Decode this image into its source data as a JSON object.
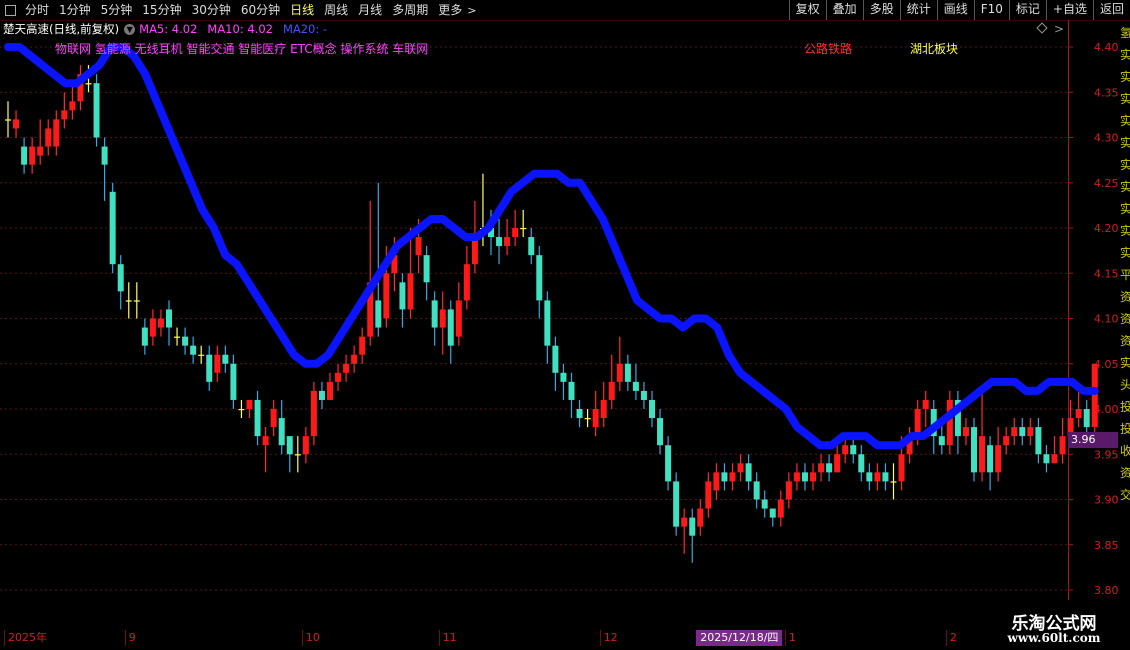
{
  "toolbar": {
    "periods": [
      "分时",
      "1分钟",
      "5分钟",
      "15分钟",
      "30分钟",
      "60分钟",
      "日线",
      "周线",
      "月线",
      "多周期",
      "更多"
    ],
    "active_period": "日线",
    "buttons": [
      "复权",
      "叠加",
      "多股",
      "统计",
      "画线",
      "F10",
      "标记",
      "+自选",
      "返回"
    ]
  },
  "info": {
    "stock_name": "楚天高速(日线,前复权)",
    "ma5": "MA5: 4.02",
    "ma10": "MA10: 4.02",
    "ma20": "MA20: -"
  },
  "concepts": "物联网 氢能源 无线耳机 智能交通 智能医疗 ETC概念 操作系统 车联网",
  "tags": {
    "road": "公路铁路",
    "hubei": "湖北板块"
  },
  "right_strip": "氢实实实实实实实实实实平资资资实头投投收资交",
  "price_tag": "3.96",
  "x_labels": [
    {
      "text": "2025年",
      "i": 0
    },
    {
      "text": "9",
      "i": 15
    },
    {
      "text": "10",
      "i": 37
    },
    {
      "text": "11",
      "i": 54
    },
    {
      "text": "12",
      "i": 74
    },
    {
      "text": "2025/12/18/四",
      "i": 86,
      "highlight": true
    },
    {
      "text": "1",
      "i": 97
    },
    {
      "text": "2",
      "i": 117
    }
  ],
  "watermark": {
    "title": "乐淘公式网",
    "url": "www.60lt.com"
  },
  "colors": {
    "up": "#ff1a1a",
    "down": "#40e0c0",
    "ma20": "#0a14ff",
    "ma_overlap": "#ff33ff",
    "axis": "#cc2222"
  },
  "chart_data": {
    "type": "candlestick",
    "title": "楚天高速(日线,前复权)",
    "ylim": [
      3.78,
      4.44
    ],
    "yticks": [
      3.8,
      3.85,
      3.9,
      3.95,
      4.0,
      4.05,
      4.1,
      4.15,
      4.2,
      4.25,
      4.3,
      4.35,
      4.4
    ],
    "candles": [
      [
        4.32,
        4.32,
        4.34,
        4.3
      ],
      [
        4.31,
        4.32,
        4.33,
        4.3
      ],
      [
        4.29,
        4.27,
        4.3,
        4.26
      ],
      [
        4.27,
        4.29,
        4.3,
        4.26
      ],
      [
        4.28,
        4.29,
        4.32,
        4.27
      ],
      [
        4.29,
        4.31,
        4.32,
        4.28
      ],
      [
        4.29,
        4.32,
        4.33,
        4.28
      ],
      [
        4.32,
        4.33,
        4.35,
        4.31
      ],
      [
        4.33,
        4.34,
        4.36,
        4.32
      ],
      [
        4.34,
        4.37,
        4.38,
        4.33
      ],
      [
        4.36,
        4.36,
        4.38,
        4.35
      ],
      [
        4.36,
        4.3,
        4.37,
        4.29
      ],
      [
        4.29,
        4.27,
        4.3,
        4.23
      ],
      [
        4.24,
        4.16,
        4.25,
        4.15
      ],
      [
        4.16,
        4.13,
        4.17,
        4.11
      ],
      [
        4.12,
        4.12,
        4.14,
        4.1
      ],
      [
        4.12,
        4.12,
        4.14,
        4.1
      ],
      [
        4.09,
        4.07,
        4.1,
        4.06
      ],
      [
        4.08,
        4.1,
        4.11,
        4.07
      ],
      [
        4.09,
        4.1,
        4.11,
        4.08
      ],
      [
        4.11,
        4.09,
        4.12,
        4.07
      ],
      [
        4.08,
        4.08,
        4.09,
        4.07
      ],
      [
        4.08,
        4.07,
        4.09,
        4.06
      ],
      [
        4.07,
        4.06,
        4.08,
        4.05
      ],
      [
        4.06,
        4.06,
        4.07,
        4.05
      ],
      [
        4.06,
        4.03,
        4.07,
        4.02
      ],
      [
        4.04,
        4.06,
        4.07,
        4.03
      ],
      [
        4.06,
        4.05,
        4.07,
        4.04
      ],
      [
        4.05,
        4.01,
        4.06,
        4.0
      ],
      [
        4.0,
        4.0,
        4.01,
        3.99
      ],
      [
        4.0,
        4.01,
        4.01,
        3.99
      ],
      [
        4.01,
        3.97,
        4.02,
        3.96
      ],
      [
        3.96,
        3.97,
        3.98,
        3.93
      ],
      [
        3.98,
        4.0,
        4.01,
        3.97
      ],
      [
        3.99,
        3.96,
        4.01,
        3.95
      ],
      [
        3.97,
        3.95,
        3.97,
        3.93
      ],
      [
        3.95,
        3.95,
        3.97,
        3.93
      ],
      [
        3.95,
        3.97,
        3.98,
        3.94
      ],
      [
        3.97,
        4.02,
        4.03,
        3.96
      ],
      [
        4.02,
        4.01,
        4.03,
        4.0
      ],
      [
        4.01,
        4.03,
        4.04,
        4.01
      ],
      [
        4.03,
        4.04,
        4.05,
        4.02
      ],
      [
        4.04,
        4.05,
        4.06,
        4.03
      ],
      [
        4.05,
        4.06,
        4.07,
        4.04
      ],
      [
        4.06,
        4.08,
        4.09,
        4.05
      ],
      [
        4.08,
        4.14,
        4.23,
        4.07
      ],
      [
        4.12,
        4.09,
        4.25,
        4.08
      ],
      [
        4.1,
        4.15,
        4.18,
        4.09
      ],
      [
        4.15,
        4.17,
        4.19,
        4.13
      ],
      [
        4.14,
        4.11,
        4.15,
        4.09
      ],
      [
        4.11,
        4.15,
        4.2,
        4.1
      ],
      [
        4.17,
        4.19,
        4.21,
        4.15
      ],
      [
        4.17,
        4.14,
        4.18,
        4.12
      ],
      [
        4.12,
        4.09,
        4.13,
        4.07
      ],
      [
        4.09,
        4.11,
        4.13,
        4.06
      ],
      [
        4.11,
        4.07,
        4.12,
        4.05
      ],
      [
        4.08,
        4.12,
        4.14,
        4.07
      ],
      [
        4.12,
        4.16,
        4.18,
        4.11
      ],
      [
        4.16,
        4.19,
        4.23,
        4.15
      ],
      [
        4.2,
        4.2,
        4.26,
        4.18
      ],
      [
        4.2,
        4.19,
        4.22,
        4.17
      ],
      [
        4.19,
        4.18,
        4.21,
        4.16
      ],
      [
        4.18,
        4.19,
        4.21,
        4.17
      ],
      [
        4.19,
        4.2,
        4.22,
        4.18
      ],
      [
        4.2,
        4.2,
        4.22,
        4.19
      ],
      [
        4.19,
        4.17,
        4.2,
        4.16
      ],
      [
        4.17,
        4.12,
        4.18,
        4.1
      ],
      [
        4.12,
        4.07,
        4.13,
        4.05
      ],
      [
        4.07,
        4.04,
        4.08,
        4.02
      ],
      [
        4.04,
        4.03,
        4.05,
        4.01
      ],
      [
        4.03,
        4.01,
        4.04,
        3.99
      ],
      [
        4.0,
        3.99,
        4.01,
        3.98
      ],
      [
        3.99,
        3.99,
        4.0,
        3.98
      ],
      [
        3.98,
        4.0,
        4.02,
        3.97
      ],
      [
        3.99,
        4.01,
        4.03,
        3.98
      ],
      [
        4.01,
        4.03,
        4.06,
        4.0
      ],
      [
        4.03,
        4.05,
        4.08,
        4.02
      ],
      [
        4.05,
        4.03,
        4.06,
        4.02
      ],
      [
        4.03,
        4.02,
        4.05,
        4.01
      ],
      [
        4.02,
        4.01,
        4.03,
        4.0
      ],
      [
        4.01,
        3.99,
        4.02,
        3.98
      ],
      [
        3.99,
        3.96,
        4.0,
        3.95
      ],
      [
        3.96,
        3.92,
        3.97,
        3.91
      ],
      [
        3.92,
        3.87,
        3.93,
        3.86
      ],
      [
        3.87,
        3.88,
        3.89,
        3.84
      ],
      [
        3.88,
        3.86,
        3.89,
        3.83
      ],
      [
        3.87,
        3.89,
        3.9,
        3.86
      ],
      [
        3.89,
        3.92,
        3.93,
        3.88
      ],
      [
        3.91,
        3.93,
        3.94,
        3.9
      ],
      [
        3.93,
        3.92,
        3.94,
        3.91
      ],
      [
        3.92,
        3.93,
        3.94,
        3.91
      ],
      [
        3.93,
        3.94,
        3.95,
        3.92
      ],
      [
        3.94,
        3.92,
        3.95,
        3.91
      ],
      [
        3.92,
        3.9,
        3.93,
        3.89
      ],
      [
        3.9,
        3.89,
        3.91,
        3.88
      ],
      [
        3.89,
        3.88,
        3.89,
        3.87
      ],
      [
        3.88,
        3.9,
        3.91,
        3.87
      ],
      [
        3.9,
        3.92,
        3.93,
        3.89
      ],
      [
        3.92,
        3.93,
        3.94,
        3.91
      ],
      [
        3.93,
        3.92,
        3.94,
        3.91
      ],
      [
        3.92,
        3.93,
        3.94,
        3.91
      ],
      [
        3.93,
        3.94,
        3.95,
        3.92
      ],
      [
        3.94,
        3.93,
        3.95,
        3.92
      ],
      [
        3.93,
        3.95,
        3.96,
        3.93
      ],
      [
        3.95,
        3.96,
        3.97,
        3.94
      ],
      [
        3.96,
        3.95,
        3.97,
        3.94
      ],
      [
        3.95,
        3.93,
        3.96,
        3.92
      ],
      [
        3.93,
        3.92,
        3.94,
        3.91
      ],
      [
        3.92,
        3.93,
        3.94,
        3.91
      ],
      [
        3.93,
        3.92,
        3.94,
        3.91
      ],
      [
        3.92,
        3.92,
        3.94,
        3.9
      ],
      [
        3.92,
        3.95,
        3.97,
        3.91
      ],
      [
        3.95,
        3.97,
        3.98,
        3.94
      ],
      [
        3.97,
        4.0,
        4.01,
        3.96
      ],
      [
        4.0,
        4.01,
        4.02,
        3.98
      ],
      [
        4.0,
        3.97,
        4.01,
        3.95
      ],
      [
        3.97,
        3.96,
        3.99,
        3.95
      ],
      [
        3.96,
        4.01,
        4.02,
        3.95
      ],
      [
        4.01,
        3.97,
        4.02,
        3.95
      ],
      [
        3.97,
        3.98,
        3.99,
        3.96
      ],
      [
        3.98,
        3.93,
        3.99,
        3.92
      ],
      [
        3.93,
        3.97,
        4.02,
        3.92
      ],
      [
        3.96,
        3.93,
        3.97,
        3.91
      ],
      [
        3.93,
        3.96,
        3.98,
        3.92
      ],
      [
        3.96,
        3.97,
        3.98,
        3.95
      ],
      [
        3.97,
        3.98,
        3.99,
        3.96
      ],
      [
        3.98,
        3.97,
        3.99,
        3.96
      ],
      [
        3.97,
        3.98,
        3.99,
        3.96
      ],
      [
        3.98,
        3.95,
        3.99,
        3.94
      ],
      [
        3.95,
        3.94,
        3.96,
        3.93
      ],
      [
        3.94,
        3.95,
        3.97,
        3.94
      ],
      [
        3.95,
        3.97,
        3.99,
        3.94
      ],
      [
        3.97,
        3.99,
        4.01,
        3.96
      ],
      [
        3.99,
        4.0,
        4.02,
        3.98
      ],
      [
        4.0,
        3.98,
        4.01,
        3.97
      ],
      [
        3.98,
        4.05,
        4.05,
        3.97
      ]
    ],
    "ma20": [
      4.4,
      4.4,
      4.39,
      4.38,
      4.37,
      4.36,
      4.36,
      4.37,
      4.38,
      4.4,
      4.4,
      4.39,
      4.37,
      4.34,
      4.31,
      4.28,
      4.25,
      4.22,
      4.2,
      4.17,
      4.16,
      4.14,
      4.12,
      4.1,
      4.08,
      4.06,
      4.05,
      4.05,
      4.06,
      4.08,
      4.1,
      4.12,
      4.14,
      4.16,
      4.18,
      4.19,
      4.2,
      4.21,
      4.21,
      4.2,
      4.19,
      4.19,
      4.2,
      4.22,
      4.24,
      4.25,
      4.26,
      4.26,
      4.26,
      4.25,
      4.25,
      4.23,
      4.21,
      4.18,
      4.15,
      4.12,
      4.11,
      4.1,
      4.1,
      4.09,
      4.1,
      4.1,
      4.09,
      4.06,
      4.04,
      4.03,
      4.02,
      4.01,
      4.0,
      3.98,
      3.97,
      3.96,
      3.96,
      3.97,
      3.97,
      3.97,
      3.96,
      3.96,
      3.96,
      3.97,
      3.97,
      3.98,
      3.99,
      4.0,
      4.01,
      4.02,
      4.03,
      4.03,
      4.03,
      4.02,
      4.02,
      4.03,
      4.03,
      4.03,
      4.02,
      4.02
    ]
  }
}
